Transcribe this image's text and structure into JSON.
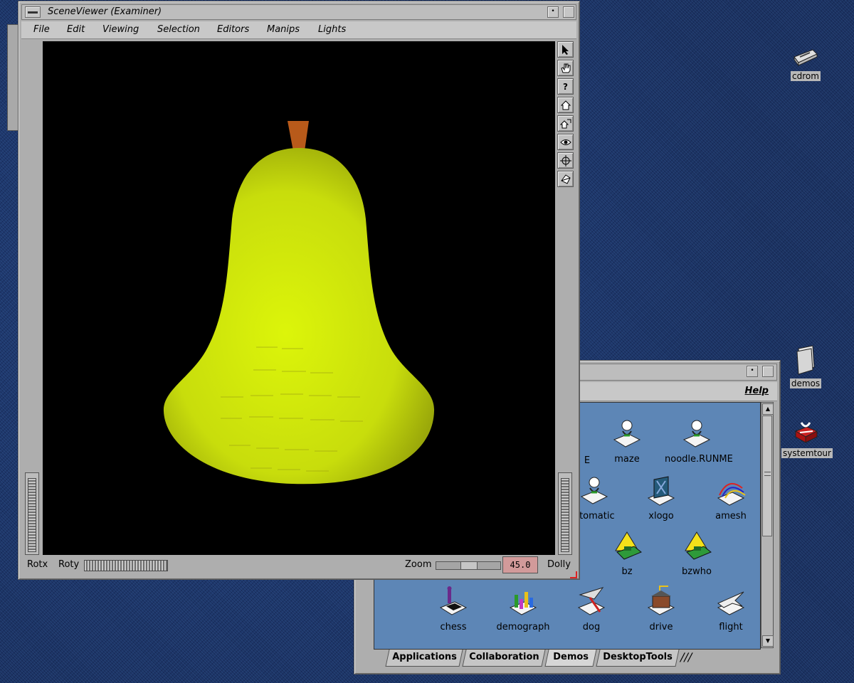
{
  "scene_viewer": {
    "title": "SceneViewer (Examiner)",
    "menus": [
      "File",
      "Edit",
      "Viewing",
      "Selection",
      "Editors",
      "Manips",
      "Lights"
    ],
    "bottom": {
      "rotx": "Rotx",
      "roty": "Roty",
      "zoom": "Zoom",
      "zoom_value": "45.0",
      "dolly": "Dolly"
    },
    "help_glyph": "?"
  },
  "demos_window": {
    "help_label": "Help",
    "items": [
      {
        "label": "E",
        "icon": "noodle-figure-icon"
      },
      {
        "label": "maze",
        "icon": "noodle-figure-icon"
      },
      {
        "label": "noodle.RUNME",
        "icon": "noodle-figure-icon"
      },
      {
        "label": "xtomatic",
        "icon": "noodle-figure-icon"
      },
      {
        "label": "xlogo",
        "icon": "xlogo-icon"
      },
      {
        "label": "amesh",
        "icon": "amesh-icon"
      },
      {
        "label": "bz",
        "icon": "tank-icon"
      },
      {
        "label": "bzwho",
        "icon": "tank-icon"
      },
      {
        "label": "chess",
        "icon": "chess-icon"
      },
      {
        "label": "demograph",
        "icon": "demograph-icon"
      },
      {
        "label": "dog",
        "icon": "dog-plane-icon"
      },
      {
        "label": "drive",
        "icon": "drive-icon"
      },
      {
        "label": "flight",
        "icon": "flight-jet-icon"
      }
    ],
    "tabs": [
      "Applications",
      "Collaboration",
      "Demos",
      "DesktopTools"
    ]
  },
  "desktop_icons": [
    {
      "label": "cdrom",
      "icon": "cdrom-icon"
    },
    {
      "label": "demos",
      "icon": "folder-icon"
    },
    {
      "label": "systemtour",
      "icon": "gift-icon"
    }
  ],
  "colors": {
    "pear": "#d7f00a",
    "stem": "#b85a1a",
    "zoom_field": "#d29a9a"
  }
}
